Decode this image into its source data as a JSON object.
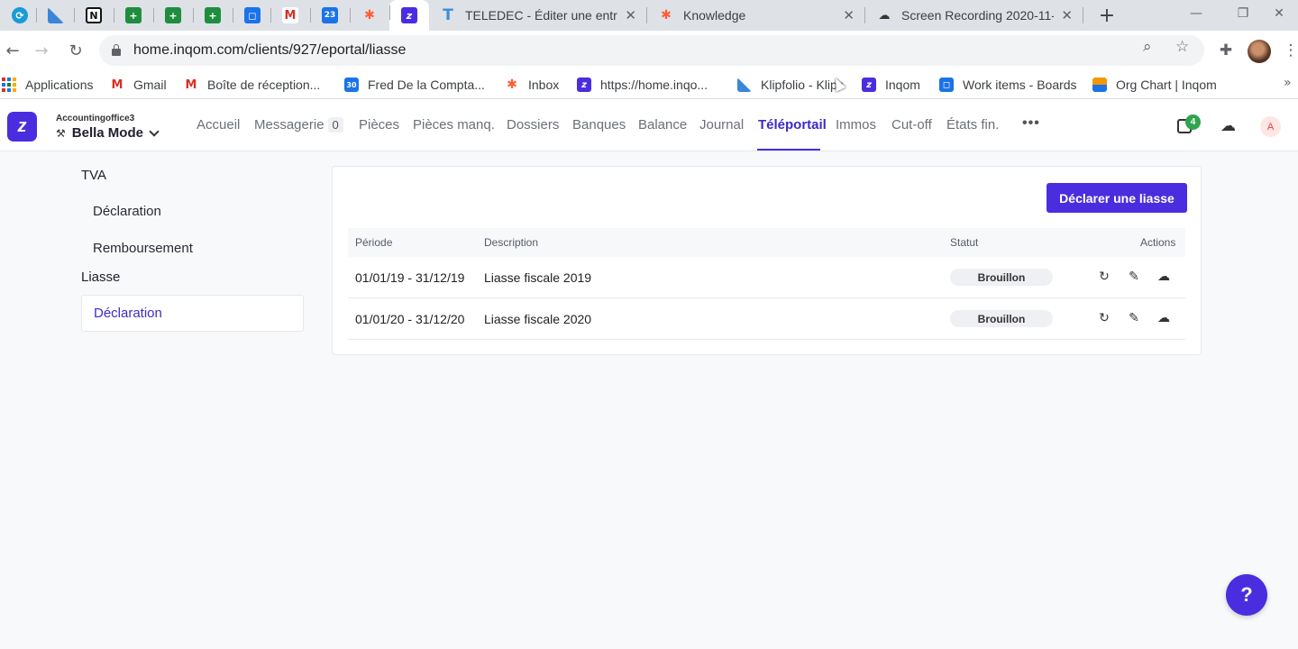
{
  "browser": {
    "pinned_tabs": [
      {
        "icon": "sync-icon",
        "color": "#1a9bd7"
      },
      {
        "icon": "klipfolio-icon",
        "color": "#3a86d8"
      },
      {
        "icon": "notion-icon",
        "color": "#111111"
      },
      {
        "icon": "sheets-plus-icon",
        "color": "#1e8e3e"
      },
      {
        "icon": "sheets-plus-icon",
        "color": "#1e8e3e"
      },
      {
        "icon": "sheets-plus-icon",
        "color": "#1e8e3e"
      },
      {
        "icon": "outlook-icon",
        "color": "#1a73e8"
      },
      {
        "icon": "gmail-icon",
        "color": "#d93025"
      },
      {
        "icon": "calendar-icon",
        "color": "#1a73e8"
      },
      {
        "icon": "hubspot-icon",
        "color": "#ff5c35"
      },
      {
        "icon": "inqom-icon",
        "color": "#4b2de0"
      }
    ],
    "tabs": [
      {
        "title": "TELEDEC - Éditer une entrep",
        "icon": "teledec-icon",
        "color": "#3a8fd8"
      },
      {
        "title": "Knowledge",
        "icon": "hubspot-icon",
        "color": "#ff5c35"
      },
      {
        "title": "Screen Recording 2020-11-",
        "icon": "cloud-icon",
        "color": "#333333"
      }
    ],
    "url": "home.inqom.com/clients/927/eportal/liasse",
    "bookmarks": [
      {
        "label": "Applications",
        "icon": "apps-grid-icon"
      },
      {
        "label": "Gmail",
        "icon": "gmail-icon",
        "color": "#d93025"
      },
      {
        "label": "Boîte de réception...",
        "icon": "gmail-icon",
        "color": "#d93025"
      },
      {
        "label": "Fred De la Compta...",
        "icon": "calendar-icon",
        "color": "#1a73e8",
        "glyph": "30"
      },
      {
        "label": "Inbox",
        "icon": "hubspot-icon",
        "color": "#ff5c35"
      },
      {
        "label": "https://home.inqo...",
        "icon": "inqom-icon",
        "color": "#4b2de0"
      },
      {
        "label": "Klipfolio - Klips",
        "icon": "klipfolio-icon",
        "color": "#3a86d8"
      },
      {
        "label": "Inqom",
        "icon": "inqom-icon",
        "color": "#4b2de0"
      },
      {
        "label": "Work items - Boards",
        "icon": "azure-boards-icon",
        "color": "#1a73e8"
      },
      {
        "label": "Org Chart | Inqom",
        "icon": "orgchart-icon",
        "color": "#f29900"
      }
    ]
  },
  "app": {
    "org_subtitle": "Accountingoffice3",
    "org_name": "Bella Mode",
    "menu": [
      {
        "label": "Accueil"
      },
      {
        "label": "Messagerie",
        "badge": "0"
      },
      {
        "label": "Pièces"
      },
      {
        "label": "Pièces manq."
      },
      {
        "label": "Dossiers"
      },
      {
        "label": "Banques"
      },
      {
        "label": "Balance"
      },
      {
        "label": "Journal"
      },
      {
        "label": "Téléportail",
        "active": true
      },
      {
        "label": "Immos"
      },
      {
        "label": "Cut-off"
      },
      {
        "label": "États fin."
      }
    ],
    "notifications_count": "4",
    "avatar_initial": "A",
    "accent_color": "#4b2de0"
  },
  "sidebar": {
    "groups": [
      {
        "title": "TVA",
        "items": [
          "Déclaration",
          "Remboursement"
        ]
      },
      {
        "title": "Liasse",
        "items": [
          "Déclaration"
        ]
      }
    ],
    "active": "Liasse / Déclaration"
  },
  "main": {
    "primary_button": "Déclarer une liasse",
    "columns": [
      "Période",
      "Description",
      "Statut",
      "Actions"
    ],
    "rows": [
      {
        "period": "01/01/19 - 31/12/19",
        "description": "Liasse fiscale 2019",
        "status": "Brouillon"
      },
      {
        "period": "01/01/20 - 31/12/20",
        "description": "Liasse fiscale 2020",
        "status": "Brouillon"
      }
    ]
  },
  "help_label": "?"
}
